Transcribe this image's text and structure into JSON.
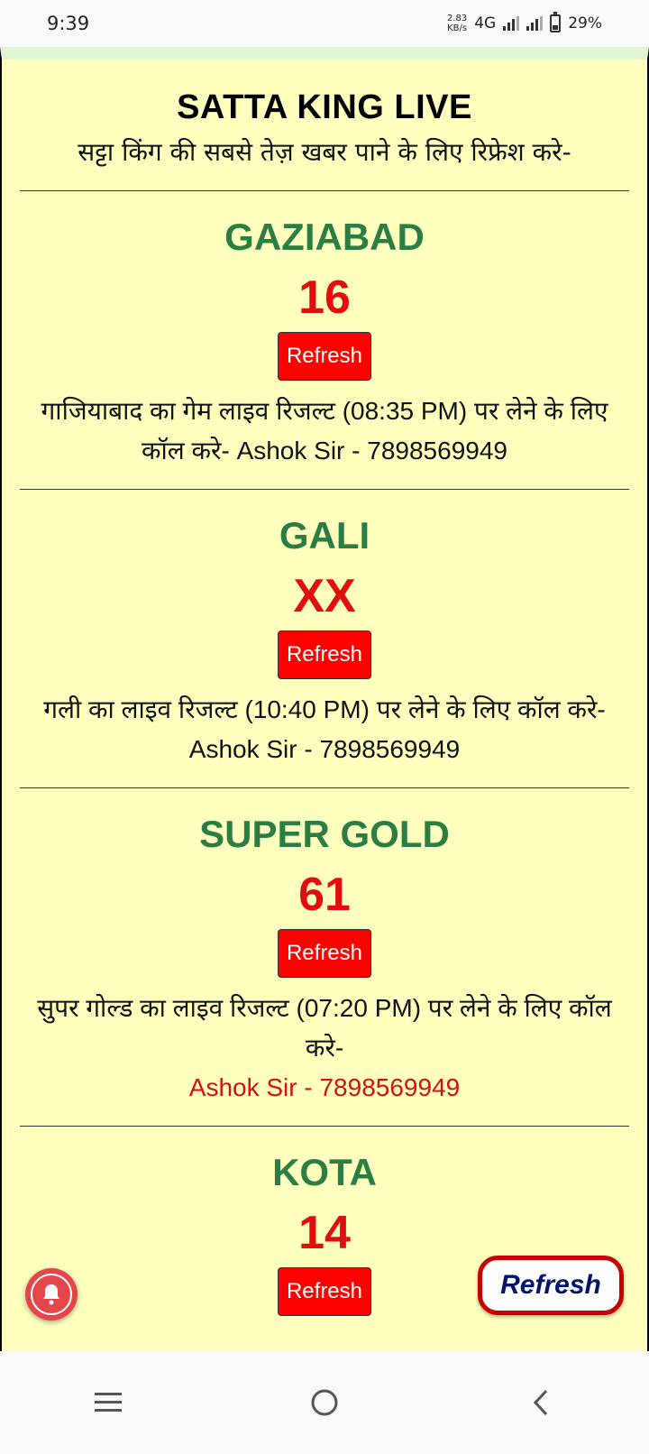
{
  "status_bar": {
    "time": "9:39",
    "speed_value": "2.83",
    "speed_unit": "KB/s",
    "network": "4G",
    "battery": "29%"
  },
  "header": {
    "title": "SATTA KING LIVE",
    "subtitle": "सट्टा किंग की सबसे तेज़ खबर पाने के लिए रिफ्रेश करे-"
  },
  "games": [
    {
      "name": "GAZIABAD",
      "result": "16",
      "refresh_label": "Refresh",
      "info": "गाजियाबाद का गेम लाइव रिजल्ट (08:35 PM) पर लेने के लिए कॉल करे- Ashok Sir - 7898569949",
      "contact": ""
    },
    {
      "name": "GALI",
      "result": "XX",
      "refresh_label": "Refresh",
      "info": "गली का लाइव रिजल्ट (10:40 PM) पर लेने के लिए कॉल करे- Ashok Sir - 7898569949",
      "contact": ""
    },
    {
      "name": "SUPER GOLD",
      "result": "61",
      "refresh_label": "Refresh",
      "info": "सुपर गोल्ड का लाइव रिजल्ट (07:20 PM) पर लेने के लिए कॉल करे-",
      "contact": "Ashok Sir - 7898569949"
    },
    {
      "name": "KOTA",
      "result": "14",
      "refresh_label": "Refresh",
      "info": "",
      "contact": ""
    }
  ],
  "floating_refresh_label": "Refresh",
  "colors": {
    "page_bg": "#ffffbe",
    "game_name": "#2a7e43",
    "result": "#e30d0d",
    "button": "#ff0000"
  },
  "icons": {
    "notification": "bell-icon",
    "nav_menu": "menu-icon",
    "nav_home": "home-icon",
    "nav_back": "back-icon"
  }
}
